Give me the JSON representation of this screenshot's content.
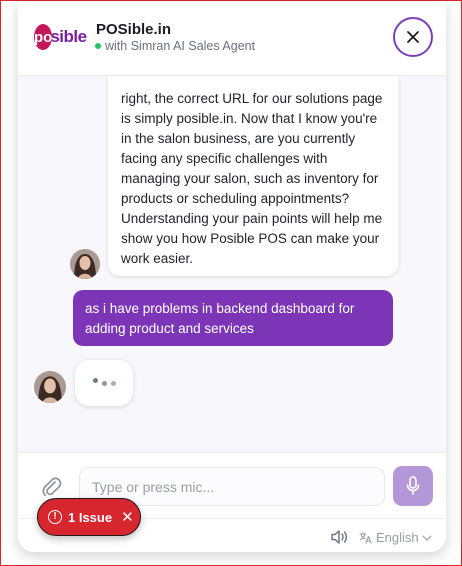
{
  "header": {
    "logo_mark": "po",
    "logo_rest": "sible",
    "title": "POSible.in",
    "subtitle": "with Simran AI Sales Agent",
    "status_color": "#22c55e"
  },
  "messages": [
    {
      "role": "agent",
      "text": "right, the correct URL for our solutions page is simply posible.in. Now that I know you're in the salon business, are you currently facing any specific challenges with managing your salon, such as inventory for products or scheduling appointments? Understanding your pain points will help me show you how Posible POS can make your work easier."
    },
    {
      "role": "user",
      "text": "as i have problems in backend dashboard for adding product and services"
    }
  ],
  "composer": {
    "placeholder": "Type or press mic..."
  },
  "footer": {
    "language": "English"
  },
  "issue_badge": {
    "label": "1 Issue"
  },
  "colors": {
    "accent": "#7d35b8",
    "mic": "#b497d6",
    "issue": "#d7262e"
  }
}
